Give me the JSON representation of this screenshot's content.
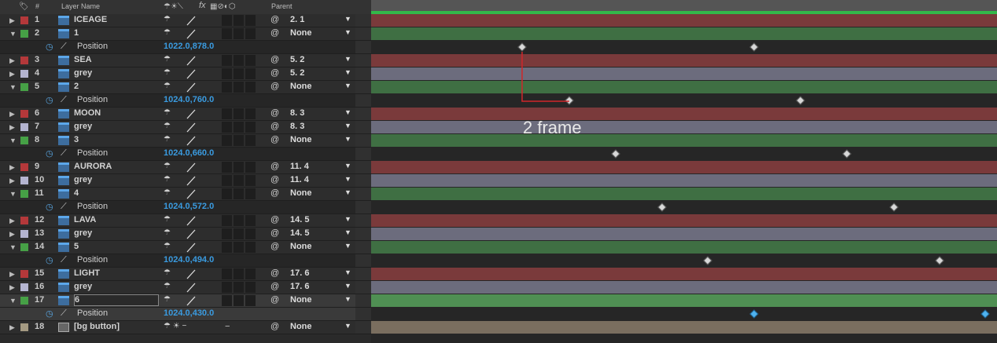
{
  "header": {
    "hash_label": "#",
    "layer_name_label": "Layer Name",
    "parent_label": "Parent",
    "fx_label": "fx"
  },
  "colors": {
    "red": "#b4383a",
    "green": "#46a046",
    "grey": "#b4b4d0",
    "tan": "#a49a82",
    "bar_red": "#7a3a3b",
    "bar_green": "#3f6f43",
    "bar_grey": "#6c6c7d",
    "bar_tan": "#7a6e5f"
  },
  "layers": [
    {
      "num": "1",
      "name": "ICEAGE",
      "parent": "2. 1",
      "color": "red",
      "twirl": "▶"
    },
    {
      "num": "2",
      "name": "1",
      "parent": "None",
      "color": "green",
      "twirl": "▼"
    },
    {
      "prop": "Position",
      "value": "1022.0,878.0"
    },
    {
      "num": "3",
      "name": "SEA",
      "parent": "5. 2",
      "color": "red",
      "twirl": "▶"
    },
    {
      "num": "4",
      "name": "grey",
      "parent": "5. 2",
      "color": "grey",
      "twirl": "▶"
    },
    {
      "num": "5",
      "name": "2",
      "parent": "None",
      "color": "green",
      "twirl": "▼"
    },
    {
      "prop": "Position",
      "value": "1024.0,760.0"
    },
    {
      "num": "6",
      "name": "MOON",
      "parent": "8. 3",
      "color": "red",
      "twirl": "▶"
    },
    {
      "num": "7",
      "name": "grey",
      "parent": "8. 3",
      "color": "grey",
      "twirl": "▶"
    },
    {
      "num": "8",
      "name": "3",
      "parent": "None",
      "color": "green",
      "twirl": "▼"
    },
    {
      "prop": "Position",
      "value": "1024.0,660.0"
    },
    {
      "num": "9",
      "name": "AURORA",
      "parent": "11. 4",
      "color": "red",
      "twirl": "▶"
    },
    {
      "num": "10",
      "name": "grey",
      "parent": "11. 4",
      "color": "grey",
      "twirl": "▶"
    },
    {
      "num": "11",
      "name": "4",
      "parent": "None",
      "color": "green",
      "twirl": "▼"
    },
    {
      "prop": "Position",
      "value": "1024.0,572.0"
    },
    {
      "num": "12",
      "name": "LAVA",
      "parent": "14. 5",
      "color": "red",
      "twirl": "▶"
    },
    {
      "num": "13",
      "name": "grey",
      "parent": "14. 5",
      "color": "grey",
      "twirl": "▶"
    },
    {
      "num": "14",
      "name": "5",
      "parent": "None",
      "color": "green",
      "twirl": "▼"
    },
    {
      "prop": "Position",
      "value": "1024.0,494.0"
    },
    {
      "num": "15",
      "name": "LIGHT",
      "parent": "17. 6",
      "color": "red",
      "twirl": "▶"
    },
    {
      "num": "16",
      "name": "grey",
      "parent": "17. 6",
      "color": "grey",
      "twirl": "▶"
    },
    {
      "num": "17",
      "name": "6",
      "parent": "None",
      "color": "green",
      "twirl": "▼",
      "selected": true
    },
    {
      "prop": "Position",
      "value": "1024.0,430.0",
      "selected": true
    },
    {
      "num": "18",
      "name": "[bg button]",
      "parent": "None",
      "color": "tan",
      "twirl": "▶",
      "bg": true
    }
  ],
  "annotation": {
    "text": "2 frame"
  }
}
